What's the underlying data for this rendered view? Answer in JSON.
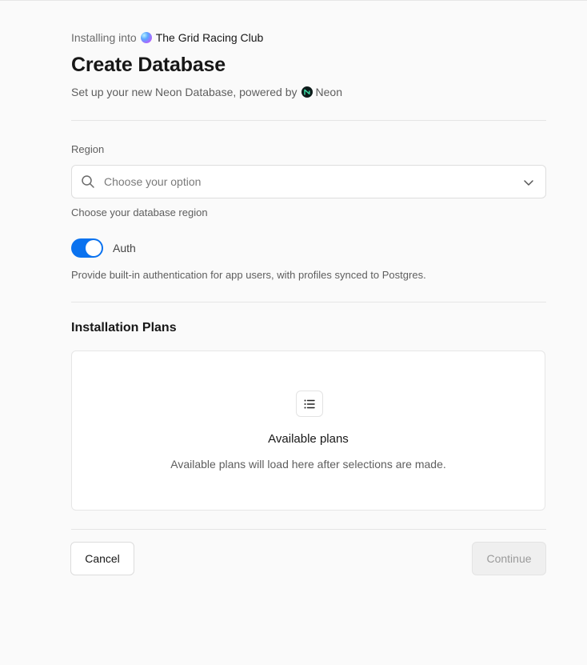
{
  "header": {
    "installing_prefix": "Installing into",
    "team_name": "The Grid Racing Club",
    "title": "Create Database",
    "subtitle_prefix": "Set up your new Neon Database, powered by",
    "provider_name": "Neon"
  },
  "region": {
    "label": "Region",
    "placeholder": "Choose your option",
    "help": "Choose your database region"
  },
  "auth": {
    "label": "Auth",
    "enabled": true,
    "help": "Provide built-in authentication for app users, with profiles synced to Postgres."
  },
  "plans": {
    "title": "Installation Plans",
    "empty_heading": "Available plans",
    "empty_description": "Available plans will load here after selections are made."
  },
  "footer": {
    "cancel_label": "Cancel",
    "continue_label": "Continue"
  },
  "colors": {
    "accent": "#0a72ef",
    "background": "#fafafa"
  }
}
